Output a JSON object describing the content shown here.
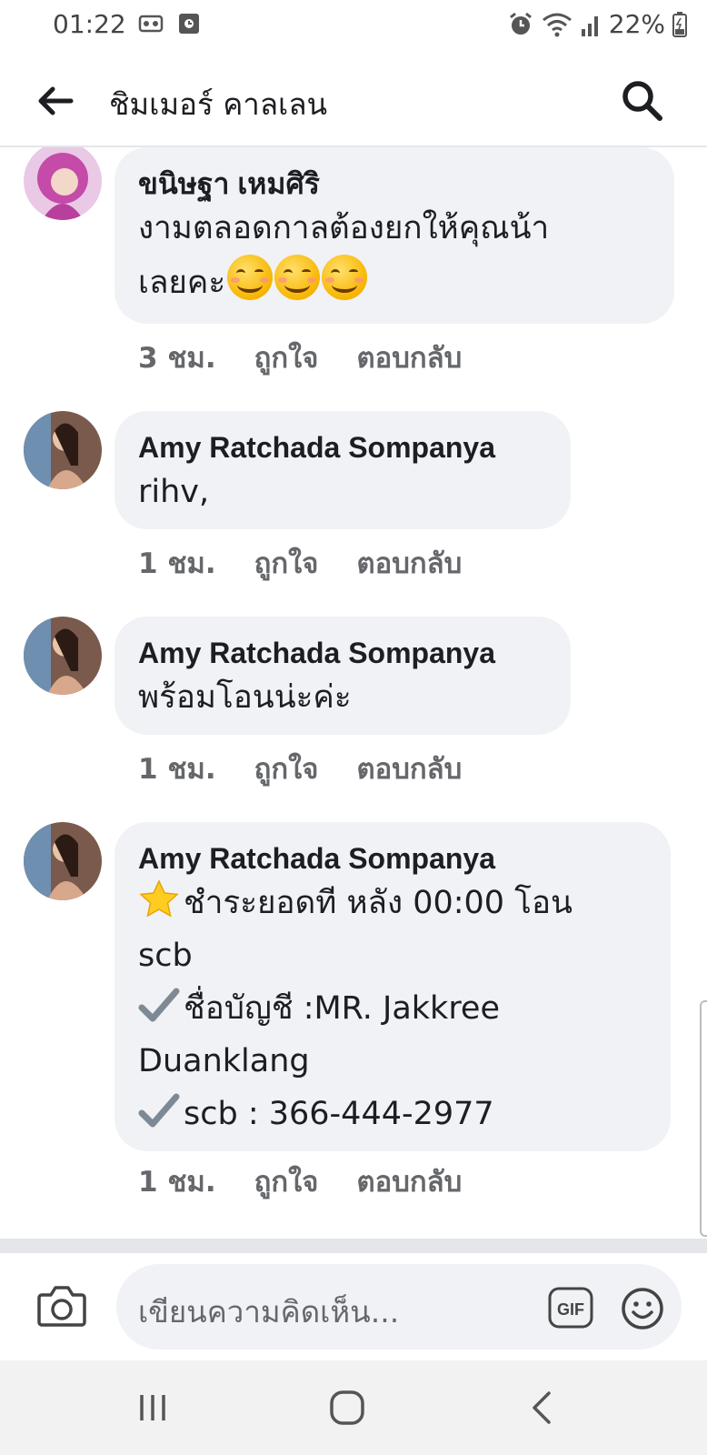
{
  "status_bar": {
    "time": "01:22",
    "battery": "22%",
    "icons": [
      "vr-icon",
      "photo-icon",
      "alarm-icon",
      "wifi-icon",
      "signal-icon",
      "battery-icon"
    ]
  },
  "header": {
    "title": "ชิมเมอร์ คาลเลน",
    "icons": [
      "back-arrow-icon",
      "search-icon"
    ]
  },
  "comments": [
    {
      "author": "ขนิษฐา เหมศิริ",
      "lines": [
        "งามตลอดกาลต้องยกให้คุณน้า",
        "เลยคะ"
      ],
      "emoji_count": 3,
      "time": "3 ชม.",
      "like": "ถูกใจ",
      "reply": "ตอบกลับ"
    },
    {
      "author": "Amy Ratchada Sompanya",
      "lines": [
        "rihv,"
      ],
      "time": "1 ชม.",
      "like": "ถูกใจ",
      "reply": "ตอบกลับ"
    },
    {
      "author": "Amy Ratchada Sompanya",
      "lines": [
        "พร้อมโอนน่ะค่ะ"
      ],
      "time": "1 ชม.",
      "like": "ถูกใจ",
      "reply": "ตอบกลับ"
    },
    {
      "author": "Amy Ratchada Sompanya",
      "lines": [
        "ชำระยอดที หลัง 00:00 โอน",
        "scb",
        "ชื่อบัญชี :MR. Jakkree",
        "Duanklang",
        "scb : 366-444-2977"
      ],
      "time": "1 ชม.",
      "like": "ถูกใจ",
      "reply": "ตอบกลับ"
    }
  ],
  "composer": {
    "placeholder": "เขียนความคิดเห็น...",
    "gif_label": "GIF"
  },
  "colors": {
    "bubble": "#f0f2f5",
    "meta_text": "#65676b",
    "primary_text": "#1c1e21"
  }
}
